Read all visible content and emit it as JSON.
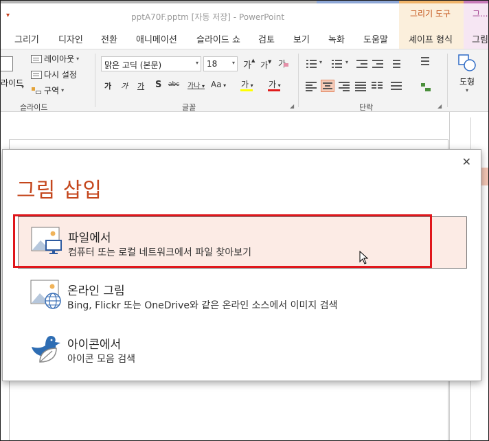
{
  "window": {
    "title": "pptA70F.pptm [자동 저장]  -  PowerPoint",
    "context_tab_1": "그리기 도구",
    "context_tab_2": "그..."
  },
  "tabs": [
    "그리기",
    "디자인",
    "전환",
    "애니메이션",
    "슬라이드 쇼",
    "검토",
    "보기",
    "녹화",
    "도움말",
    "셰이프 형식",
    "그림"
  ],
  "ribbon": {
    "slides": {
      "new_slide_partial": "라이드",
      "layout": "레이아웃",
      "reset": "다시 설정",
      "section": "구역",
      "group_label": "슬라이드"
    },
    "font": {
      "font_name": "맑은 고딕 (본문)",
      "font_size": "18",
      "grow": "가",
      "shrink": "가",
      "clear": "가",
      "bold": "가",
      "italic": "가",
      "underline": "가",
      "shadow": "S",
      "strike": "abc",
      "spacing": "가나",
      "case": "Aa",
      "highlight": "가",
      "color": "가",
      "group_label": "글꼴"
    },
    "paragraph": {
      "group_label": "단락"
    },
    "drawing": {
      "shape_label": "도형"
    },
    "colors": {
      "accent": "#c4461c",
      "highlight_bar": "#ffff00",
      "font_color_bar": "#e01b1b"
    }
  },
  "dialog": {
    "title": "그림 삽입",
    "close_icon": "close-icon",
    "options": [
      {
        "title": "파일에서",
        "desc": "컴퓨터 또는 로컬 네트워크에서 파일 찾아보기",
        "icon": "picture-computer-icon"
      },
      {
        "title": "온라인 그림",
        "desc": "Bing, Flickr 또는 OneDrive와 같은 온라인 소스에서 이미지 검색",
        "icon": "picture-globe-icon"
      },
      {
        "title": "아이콘에서",
        "desc": "아이콘 모음 검색",
        "icon": "bird-leaf-icon"
      }
    ],
    "highlight_color": "#e0161b"
  }
}
